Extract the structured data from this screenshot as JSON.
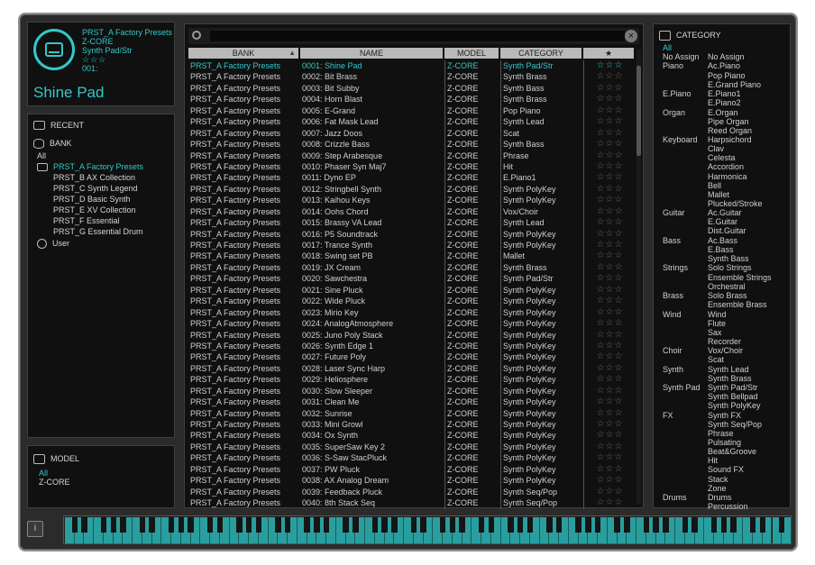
{
  "preset": {
    "bank": "PRST_A Factory Presets",
    "model": "Z-CORE",
    "category": "Synth Pad/Str",
    "stars": "☆☆☆",
    "number": "001:",
    "name": "Shine Pad"
  },
  "browse": {
    "recent_label": "RECENT",
    "bank_label": "BANK",
    "all_label": "All",
    "banks": [
      "PRST_A Factory Presets",
      "PRST_B AX Collection",
      "PRST_C Synth Legend",
      "PRST_D Basic Synth",
      "PRST_E XV Collection",
      "PRST_F Essential",
      "PRST_G Essential Drum"
    ],
    "user_label": "User"
  },
  "model_panel": {
    "label": "MODEL",
    "all": "All",
    "item": "Z-CORE"
  },
  "list": {
    "headers": {
      "bank": "BANK",
      "name": "NAME",
      "model": "MODEL",
      "category": "CATEGORY",
      "fav": "★"
    },
    "sort_icon": "▲",
    "clear_icon": "×",
    "rows": [
      {
        "bank": "PRST_A Factory Presets",
        "name": "0001: Shine Pad",
        "model": "Z-CORE",
        "cat": "Synth Pad/Str",
        "fav": "☆☆☆"
      },
      {
        "bank": "PRST_A Factory Presets",
        "name": "0002: Bit Brass",
        "model": "Z-CORE",
        "cat": "Synth Brass",
        "fav": "☆☆☆"
      },
      {
        "bank": "PRST_A Factory Presets",
        "name": "0003: Bit Subby",
        "model": "Z-CORE",
        "cat": "Synth Bass",
        "fav": "☆☆☆"
      },
      {
        "bank": "PRST_A Factory Presets",
        "name": "0004: Horn Blast",
        "model": "Z-CORE",
        "cat": "Synth Brass",
        "fav": "☆☆☆"
      },
      {
        "bank": "PRST_A Factory Presets",
        "name": "0005: E-Grand",
        "model": "Z-CORE",
        "cat": "Pop Piano",
        "fav": "☆☆☆"
      },
      {
        "bank": "PRST_A Factory Presets",
        "name": "0006: Fat Mask Lead",
        "model": "Z-CORE",
        "cat": "Synth Lead",
        "fav": "☆☆☆"
      },
      {
        "bank": "PRST_A Factory Presets",
        "name": "0007: Jazz Doos",
        "model": "Z-CORE",
        "cat": "Scat",
        "fav": "☆☆☆"
      },
      {
        "bank": "PRST_A Factory Presets",
        "name": "0008: Crizzle Bass",
        "model": "Z-CORE",
        "cat": "Synth Bass",
        "fav": "☆☆☆"
      },
      {
        "bank": "PRST_A Factory Presets",
        "name": "0009: Step Arabesque",
        "model": "Z-CORE",
        "cat": "Phrase",
        "fav": "☆☆☆"
      },
      {
        "bank": "PRST_A Factory Presets",
        "name": "0010: Phaser Syn Maj7",
        "model": "Z-CORE",
        "cat": "Hit",
        "fav": "☆☆☆"
      },
      {
        "bank": "PRST_A Factory Presets",
        "name": "0011: Dyno EP",
        "model": "Z-CORE",
        "cat": "E.Piano1",
        "fav": "☆☆☆"
      },
      {
        "bank": "PRST_A Factory Presets",
        "name": "0012: Stringbell Synth",
        "model": "Z-CORE",
        "cat": "Synth PolyKey",
        "fav": "☆☆☆"
      },
      {
        "bank": "PRST_A Factory Presets",
        "name": "0013: Kaihou Keys",
        "model": "Z-CORE",
        "cat": "Synth PolyKey",
        "fav": "☆☆☆"
      },
      {
        "bank": "PRST_A Factory Presets",
        "name": "0014: Oohs Chord",
        "model": "Z-CORE",
        "cat": "Vox/Choir",
        "fav": "☆☆☆"
      },
      {
        "bank": "PRST_A Factory Presets",
        "name": "0015: Brassy VA Lead",
        "model": "Z-CORE",
        "cat": "Synth Lead",
        "fav": "☆☆☆"
      },
      {
        "bank": "PRST_A Factory Presets",
        "name": "0016: P5 Soundtrack",
        "model": "Z-CORE",
        "cat": "Synth PolyKey",
        "fav": "☆☆☆"
      },
      {
        "bank": "PRST_A Factory Presets",
        "name": "0017: Trance Synth",
        "model": "Z-CORE",
        "cat": "Synth PolyKey",
        "fav": "☆☆☆"
      },
      {
        "bank": "PRST_A Factory Presets",
        "name": "0018: Swing set PB",
        "model": "Z-CORE",
        "cat": "Mallet",
        "fav": "☆☆☆"
      },
      {
        "bank": "PRST_A Factory Presets",
        "name": "0019: JX Cream",
        "model": "Z-CORE",
        "cat": "Synth Brass",
        "fav": "☆☆☆"
      },
      {
        "bank": "PRST_A Factory Presets",
        "name": "0020: Sawchestra",
        "model": "Z-CORE",
        "cat": "Synth Pad/Str",
        "fav": "☆☆☆"
      },
      {
        "bank": "PRST_A Factory Presets",
        "name": "0021: Sine Pluck",
        "model": "Z-CORE",
        "cat": "Synth PolyKey",
        "fav": "☆☆☆"
      },
      {
        "bank": "PRST_A Factory Presets",
        "name": "0022: Wide Pluck",
        "model": "Z-CORE",
        "cat": "Synth PolyKey",
        "fav": "☆☆☆"
      },
      {
        "bank": "PRST_A Factory Presets",
        "name": "0023: Mirio Key",
        "model": "Z-CORE",
        "cat": "Synth PolyKey",
        "fav": "☆☆☆"
      },
      {
        "bank": "PRST_A Factory Presets",
        "name": "0024: AnalogAtmosphere",
        "model": "Z-CORE",
        "cat": "Synth PolyKey",
        "fav": "☆☆☆"
      },
      {
        "bank": "PRST_A Factory Presets",
        "name": "0025: Juno Poly Stack",
        "model": "Z-CORE",
        "cat": "Synth PolyKey",
        "fav": "☆☆☆"
      },
      {
        "bank": "PRST_A Factory Presets",
        "name": "0026: Synth Edge 1",
        "model": "Z-CORE",
        "cat": "Synth PolyKey",
        "fav": "☆☆☆"
      },
      {
        "bank": "PRST_A Factory Presets",
        "name": "0027: Future Poly",
        "model": "Z-CORE",
        "cat": "Synth PolyKey",
        "fav": "☆☆☆"
      },
      {
        "bank": "PRST_A Factory Presets",
        "name": "0028: Laser Sync Harp",
        "model": "Z-CORE",
        "cat": "Synth PolyKey",
        "fav": "☆☆☆"
      },
      {
        "bank": "PRST_A Factory Presets",
        "name": "0029: Heliosphere",
        "model": "Z-CORE",
        "cat": "Synth PolyKey",
        "fav": "☆☆☆"
      },
      {
        "bank": "PRST_A Factory Presets",
        "name": "0030: Slow Sleeper",
        "model": "Z-CORE",
        "cat": "Synth PolyKey",
        "fav": "☆☆☆"
      },
      {
        "bank": "PRST_A Factory Presets",
        "name": "0031: Clean Me",
        "model": "Z-CORE",
        "cat": "Synth PolyKey",
        "fav": "☆☆☆"
      },
      {
        "bank": "PRST_A Factory Presets",
        "name": "0032: Sunrise",
        "model": "Z-CORE",
        "cat": "Synth PolyKey",
        "fav": "☆☆☆"
      },
      {
        "bank": "PRST_A Factory Presets",
        "name": "0033: Mini Growl",
        "model": "Z-CORE",
        "cat": "Synth PolyKey",
        "fav": "☆☆☆"
      },
      {
        "bank": "PRST_A Factory Presets",
        "name": "0034: Ox Synth",
        "model": "Z-CORE",
        "cat": "Synth PolyKey",
        "fav": "☆☆☆"
      },
      {
        "bank": "PRST_A Factory Presets",
        "name": "0035: SuperSaw Key 2",
        "model": "Z-CORE",
        "cat": "Synth PolyKey",
        "fav": "☆☆☆"
      },
      {
        "bank": "PRST_A Factory Presets",
        "name": "0036: S-Saw StacPluck",
        "model": "Z-CORE",
        "cat": "Synth PolyKey",
        "fav": "☆☆☆"
      },
      {
        "bank": "PRST_A Factory Presets",
        "name": "0037: PW Pluck",
        "model": "Z-CORE",
        "cat": "Synth PolyKey",
        "fav": "☆☆☆"
      },
      {
        "bank": "PRST_A Factory Presets",
        "name": "0038: AX Analog Dream",
        "model": "Z-CORE",
        "cat": "Synth PolyKey",
        "fav": "☆☆☆"
      },
      {
        "bank": "PRST_A Factory Presets",
        "name": "0039: Feedback Pluck",
        "model": "Z-CORE",
        "cat": "Synth Seq/Pop",
        "fav": "☆☆☆"
      },
      {
        "bank": "PRST_A Factory Presets",
        "name": "0040: 8th Stack Seq",
        "model": "Z-CORE",
        "cat": "Synth Seq/Pop",
        "fav": "☆☆☆"
      }
    ]
  },
  "category_panel": {
    "label": "CATEGORY",
    "all": "All",
    "groups": [
      {
        "group": "No Assign",
        "items": [
          "No Assign"
        ]
      },
      {
        "group": "Piano",
        "items": [
          "Ac.Piano",
          "Pop Piano",
          "E.Grand Piano"
        ]
      },
      {
        "group": "E.Piano",
        "items": [
          "E.Piano1",
          "E.Piano2"
        ]
      },
      {
        "group": "Organ",
        "items": [
          "E.Organ",
          "Pipe Organ",
          "Reed Organ"
        ]
      },
      {
        "group": "Keyboard",
        "items": [
          "Harpsichord",
          "Clav",
          "Celesta",
          "Accordion",
          "Harmonica",
          "Bell",
          "Mallet",
          "Plucked/Stroke"
        ]
      },
      {
        "group": "Guitar",
        "items": [
          "Ac.Guitar",
          "E.Guitar",
          "Dist.Guitar"
        ]
      },
      {
        "group": "Bass",
        "items": [
          "Ac.Bass",
          "E.Bass",
          "Synth Bass"
        ]
      },
      {
        "group": "Strings",
        "items": [
          "Solo Strings",
          "Ensemble Strings",
          "Orchestral"
        ]
      },
      {
        "group": "Brass",
        "items": [
          "Solo Brass",
          "Ensemble Brass"
        ]
      },
      {
        "group": "Wind",
        "items": [
          "Wind",
          "Flute",
          "Sax",
          "Recorder"
        ]
      },
      {
        "group": "Choir",
        "items": [
          "Vox/Choir",
          "Scat"
        ]
      },
      {
        "group": "Synth",
        "items": [
          "Synth Lead",
          "Synth Brass"
        ]
      },
      {
        "group": "Synth Pad",
        "items": [
          "Synth Pad/Str",
          "Synth Bellpad",
          "Synth PolyKey"
        ]
      },
      {
        "group": "FX",
        "items": [
          "Synth FX",
          "Synth Seq/Pop",
          "Phrase",
          "Pulsating",
          "Beat&Groove",
          "Hit",
          "Sound FX",
          "Stack",
          "Zone"
        ]
      },
      {
        "group": "Drums",
        "items": [
          "Drums",
          "Percussion"
        ]
      }
    ]
  },
  "keyboard": {
    "info_label": "i"
  },
  "colors": {
    "accent": "#33c8c8",
    "panel": "#101010",
    "frame": "#2b2b2b",
    "keys": "#2a9e9e"
  }
}
